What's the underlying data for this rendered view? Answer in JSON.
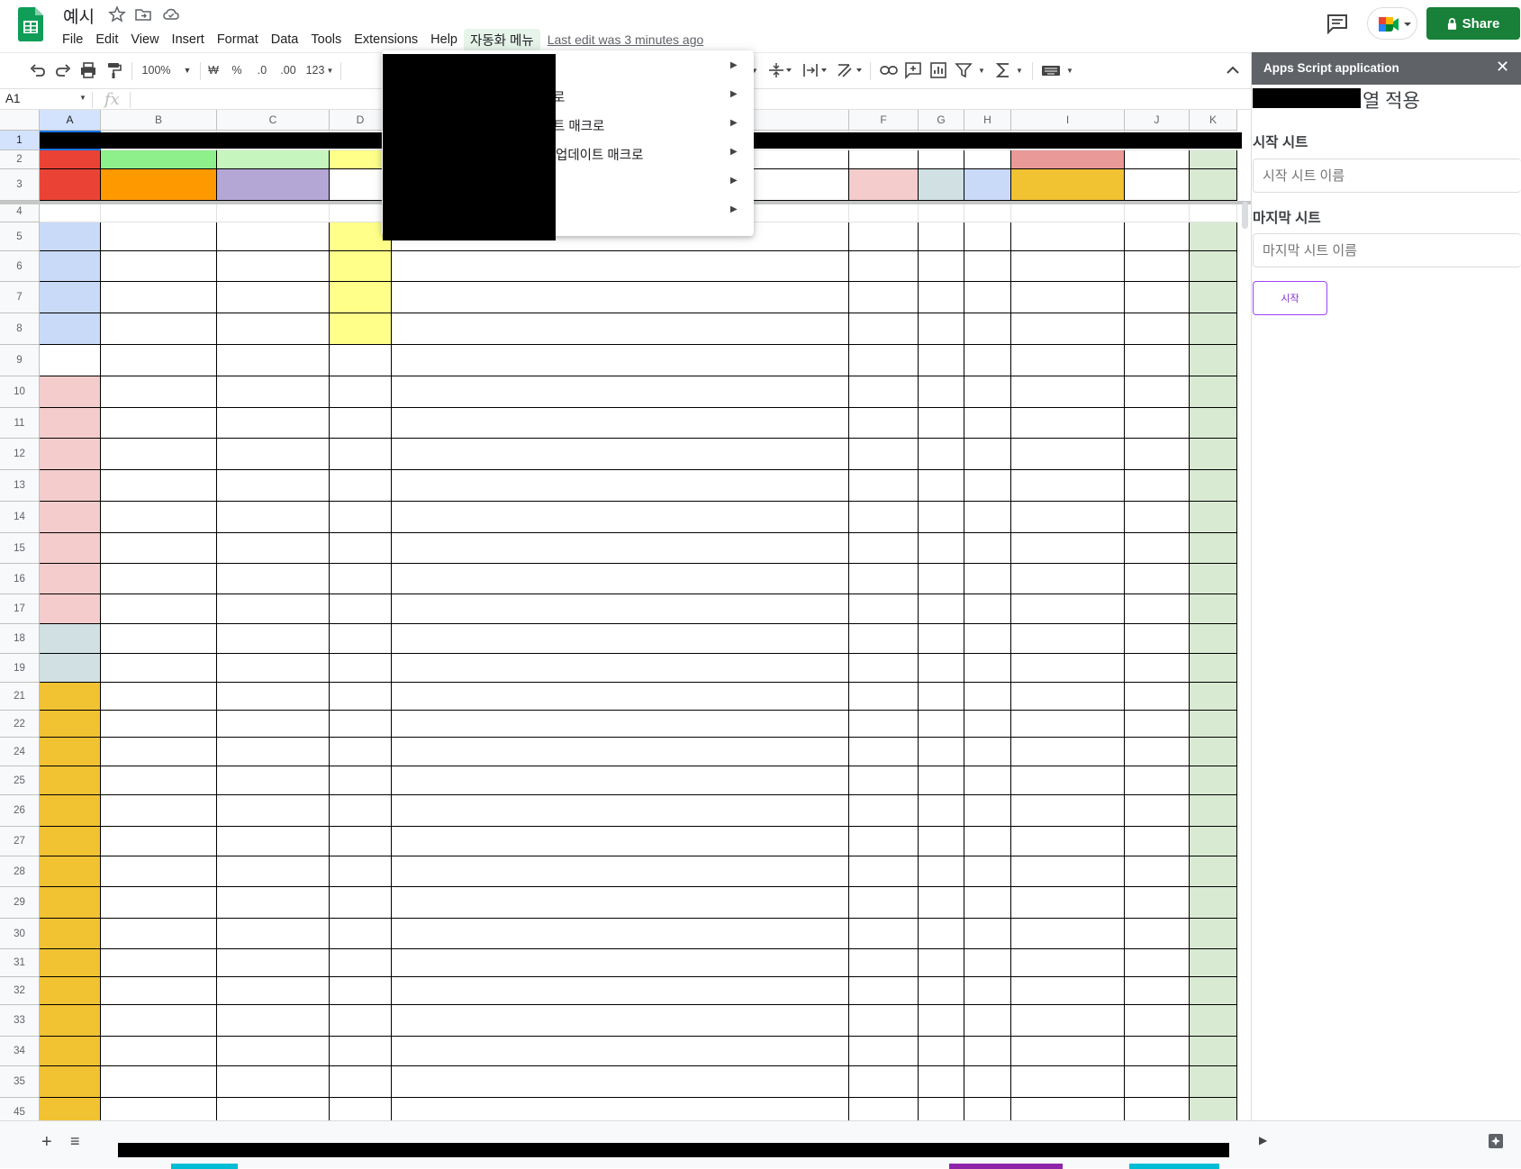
{
  "app": {
    "title": "예시",
    "menu": [
      "File",
      "Edit",
      "View",
      "Insert",
      "Format",
      "Data",
      "Tools",
      "Extensions",
      "Help",
      "자동화 메뉴"
    ],
    "active_menu": "자동화 메뉴",
    "last_edit": "Last edit was 3 minutes ago",
    "share_label": "Share",
    "brand_green": "#188038",
    "icons": [
      "sheets-logo-icon",
      "star-icon",
      "move-folder-icon",
      "cloud-status-icon",
      "comment-icon",
      "meet-icon",
      "lock-icon"
    ]
  },
  "toolbar": {
    "zoom": "100%",
    "currency": "₩",
    "percent": "%",
    "decrease_decimal": ".0",
    "increase_decimal": ".00",
    "more_formats": "123"
  },
  "formula_bar": {
    "cell_ref": "A1",
    "fx": "fx"
  },
  "grid": {
    "columns": [
      "A",
      "B",
      "C",
      "D",
      "E",
      "F",
      "G",
      "H",
      "I",
      "J",
      "K"
    ],
    "rows": [
      "1",
      "2",
      "3",
      "4",
      "5",
      "6",
      "7",
      "8",
      "9",
      "10",
      "11",
      "12",
      "13",
      "14",
      "15",
      "16",
      "17",
      "18",
      "19",
      "21",
      "22",
      "24",
      "25",
      "26",
      "27",
      "28",
      "29",
      "30",
      "31",
      "32",
      "33",
      "34",
      "35",
      "45"
    ],
    "selected_cell": "A1"
  },
  "dropdown": {
    "items": [
      {
        "label": ""
      },
      {
        "label": "로"
      },
      {
        "label": "트 매크로"
      },
      {
        "label": "업데이트 매크로"
      },
      {
        "label": ""
      },
      {
        "label": ""
      }
    ]
  },
  "sidepanel": {
    "title": "Apps Script application",
    "close": "✕",
    "heading": "열 적용",
    "start_sheet_label": "시작 시트",
    "start_sheet_placeholder": "시작 시트 이름",
    "end_sheet_label": "마지막 시트",
    "end_sheet_placeholder": "마지막 시트 이름",
    "start_button": "시작",
    "accent": "#a142f4"
  },
  "bottom": {
    "add_sheet": "+",
    "all_sheets": "≡"
  }
}
